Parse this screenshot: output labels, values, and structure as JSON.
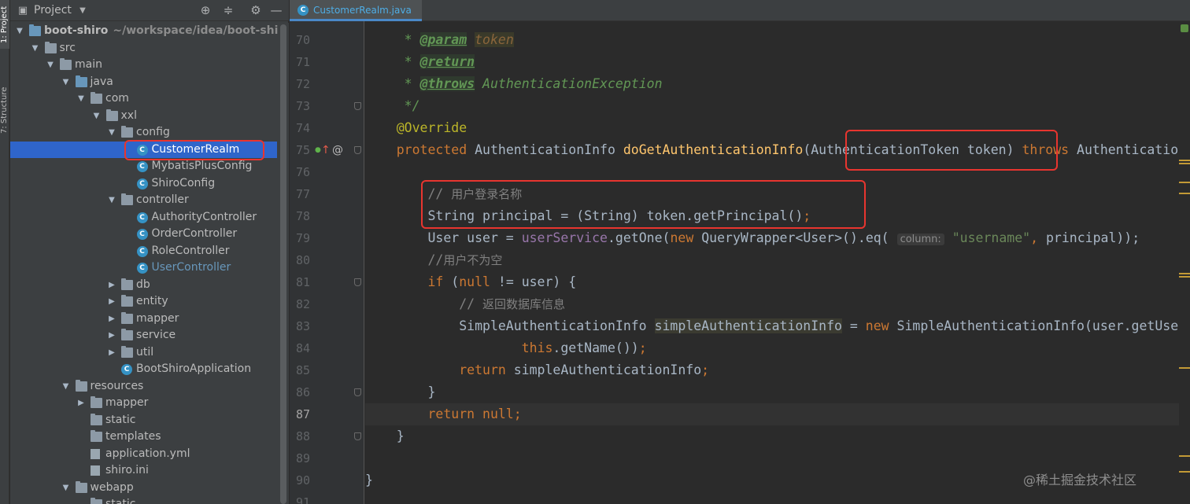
{
  "tool_strip": {
    "project_tab": "1: Project",
    "structure_tab": "7: Structure"
  },
  "project_panel": {
    "title": "Project",
    "tree": [
      {
        "label": "boot-shiro",
        "sub": "~/workspace/idea/boot-shiro",
        "depth": 0,
        "expanded": true,
        "icon": "module-folder-icon",
        "bold": true
      },
      {
        "label": "src",
        "depth": 1,
        "expanded": true,
        "icon": "folder-icon"
      },
      {
        "label": "main",
        "depth": 2,
        "expanded": true,
        "icon": "folder-icon"
      },
      {
        "label": "java",
        "depth": 3,
        "expanded": true,
        "icon": "source-folder-icon"
      },
      {
        "label": "com",
        "depth": 4,
        "expanded": true,
        "icon": "package-icon"
      },
      {
        "label": "xxl",
        "depth": 5,
        "expanded": true,
        "icon": "package-icon"
      },
      {
        "label": "config",
        "depth": 6,
        "expanded": true,
        "icon": "package-icon"
      },
      {
        "label": "CustomerRealm",
        "depth": 7,
        "icon": "class-icon",
        "selected": true
      },
      {
        "label": "MybatisPlusConfig",
        "depth": 7,
        "icon": "class-icon"
      },
      {
        "label": "ShiroConfig",
        "depth": 7,
        "icon": "class-icon"
      },
      {
        "label": "controller",
        "depth": 6,
        "expanded": true,
        "icon": "package-icon"
      },
      {
        "label": "AuthorityController",
        "depth": 7,
        "icon": "class-icon"
      },
      {
        "label": "OrderController",
        "depth": 7,
        "icon": "class-icon"
      },
      {
        "label": "RoleController",
        "depth": 7,
        "icon": "class-icon"
      },
      {
        "label": "UserController",
        "depth": 7,
        "icon": "class-icon",
        "vcs": true
      },
      {
        "label": "db",
        "depth": 6,
        "expanded": false,
        "icon": "package-icon"
      },
      {
        "label": "entity",
        "depth": 6,
        "expanded": false,
        "icon": "package-icon"
      },
      {
        "label": "mapper",
        "depth": 6,
        "expanded": false,
        "icon": "package-icon"
      },
      {
        "label": "service",
        "depth": 6,
        "expanded": false,
        "icon": "package-icon"
      },
      {
        "label": "util",
        "depth": 6,
        "expanded": false,
        "icon": "package-icon"
      },
      {
        "label": "BootShiroApplication",
        "depth": 6,
        "icon": "spring-class-icon"
      },
      {
        "label": "resources",
        "depth": 3,
        "expanded": true,
        "icon": "resources-folder-icon"
      },
      {
        "label": "mapper",
        "depth": 4,
        "expanded": false,
        "icon": "folder-icon"
      },
      {
        "label": "static",
        "depth": 4,
        "icon": "folder-icon"
      },
      {
        "label": "templates",
        "depth": 4,
        "icon": "folder-icon"
      },
      {
        "label": "application.yml",
        "depth": 4,
        "icon": "yaml-file-icon"
      },
      {
        "label": "shiro.ini",
        "depth": 4,
        "icon": "ini-file-icon"
      },
      {
        "label": "webapp",
        "depth": 3,
        "expanded": true,
        "icon": "web-folder-icon"
      },
      {
        "label": "static",
        "depth": 4,
        "icon": "folder-icon"
      }
    ]
  },
  "editor": {
    "tab_label": "CustomerRealm.java",
    "current_line": "87",
    "lines": [
      {
        "n": "70",
        "tokens": [
          [
            "doc",
            "     * "
          ],
          [
            "tag",
            "@param"
          ],
          [
            "doc",
            " "
          ],
          [
            "docval",
            "token"
          ]
        ]
      },
      {
        "n": "71",
        "tokens": [
          [
            "doc",
            "     * "
          ],
          [
            "tag",
            "@return"
          ]
        ]
      },
      {
        "n": "72",
        "tokens": [
          [
            "doc",
            "     * "
          ],
          [
            "tag",
            "@throws"
          ],
          [
            "doc",
            " AuthenticationException"
          ]
        ]
      },
      {
        "n": "73",
        "tokens": [
          [
            "doc",
            "     */"
          ]
        ]
      },
      {
        "n": "74",
        "tokens": [
          [
            "ann",
            "    @Override"
          ]
        ]
      },
      {
        "n": "75",
        "tokens": [
          [
            "kw",
            "    protected "
          ],
          [
            "plain",
            "AuthenticationInfo "
          ],
          [
            "fn",
            "doGetAuthenticationInfo"
          ],
          [
            "plain",
            "(AuthenticationToken token) "
          ],
          [
            "kw",
            "throws "
          ],
          [
            "plain",
            "AuthenticationException {"
          ]
        ]
      },
      {
        "n": "76",
        "tokens": []
      },
      {
        "n": "77",
        "tokens": [
          [
            "cmt",
            "        // "
          ],
          [
            "cmtcn",
            "用户登录名称"
          ]
        ]
      },
      {
        "n": "78",
        "tokens": [
          [
            "plain",
            "        String principal = (String) token.getPrincipal()"
          ],
          [
            "kw",
            ";"
          ]
        ]
      },
      {
        "n": "79",
        "tokens": [
          [
            "plain",
            "        User user = "
          ],
          [
            "field",
            "userService"
          ],
          [
            "plain",
            ".getOne("
          ],
          [
            "kw",
            "new "
          ],
          [
            "plain",
            "QueryWrapper<User>().eq( "
          ],
          [
            "hint",
            "column:"
          ],
          [
            "plain",
            " "
          ],
          [
            "str",
            "\"username\""
          ],
          [
            "kw",
            ", "
          ],
          [
            "plain",
            "principal));"
          ]
        ]
      },
      {
        "n": "80",
        "tokens": [
          [
            "cmt",
            "        //"
          ],
          [
            "cmtcn",
            "用户不为空"
          ]
        ]
      },
      {
        "n": "81",
        "tokens": [
          [
            "kw",
            "        if "
          ],
          [
            "plain",
            "("
          ],
          [
            "kw",
            "null "
          ],
          [
            "plain",
            "!= user) {"
          ]
        ]
      },
      {
        "n": "82",
        "tokens": [
          [
            "cmt",
            "            // "
          ],
          [
            "cmtcn",
            "返回数据库信息"
          ]
        ]
      },
      {
        "n": "83",
        "tokens": [
          [
            "plain",
            "            SimpleAuthenticationInfo "
          ],
          [
            "hl",
            "simpleAuthenticationInfo"
          ],
          [
            "plain",
            " = "
          ],
          [
            "kw",
            "new "
          ],
          [
            "plain",
            "SimpleAuthenticationInfo(user.getUsername(), user.getPassword(),"
          ]
        ]
      },
      {
        "n": "84",
        "tokens": [
          [
            "kw",
            "                    this"
          ],
          [
            "plain",
            ".getName())"
          ],
          [
            "kw",
            ";"
          ]
        ]
      },
      {
        "n": "85",
        "tokens": [
          [
            "kw",
            "            return "
          ],
          [
            "plain",
            "simpleAuthenticationInfo"
          ],
          [
            "kw",
            ";"
          ]
        ]
      },
      {
        "n": "86",
        "tokens": [
          [
            "plain",
            "        }"
          ]
        ]
      },
      {
        "n": "87",
        "tokens": [
          [
            "kw",
            "        return null;"
          ]
        ]
      },
      {
        "n": "88",
        "tokens": [
          [
            "plain",
            "    }"
          ]
        ]
      },
      {
        "n": "89",
        "tokens": []
      },
      {
        "n": "90",
        "tokens": [
          [
            "plain",
            "}"
          ]
        ]
      },
      {
        "n": "91",
        "tokens": []
      }
    ]
  },
  "watermark": "@稀土掘金技术社区",
  "colors": {
    "selection": "#2f65ca",
    "highlight_box": "#e8352f",
    "keyword": "#cc7832",
    "doc_comment": "#629755",
    "annotation": "#bbb529"
  }
}
